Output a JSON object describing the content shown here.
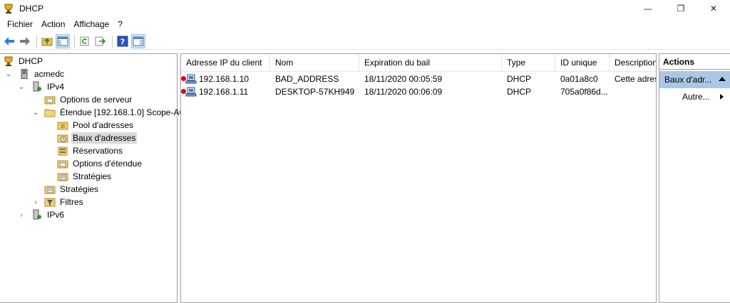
{
  "window": {
    "title": "DHCP",
    "minimize": "—",
    "maximize": "❐",
    "close": "✕"
  },
  "menu": [
    "Fichier",
    "Action",
    "Affichage",
    "?"
  ],
  "tree": {
    "root": "DHCP",
    "server": "acmedc",
    "ipv4": "IPv4",
    "server_options": "Options de serveur",
    "scope": "Étendue [192.168.1.0] Scope-AC",
    "address_pool": "Pool d'adresses",
    "address_leases": "Baux d'adresses",
    "reservations": "Réservations",
    "scope_options": "Options d'étendue",
    "scope_policies": "Stratégies",
    "policies": "Stratégies",
    "filters": "Filtres",
    "ipv6": "IPv6"
  },
  "list": {
    "columns": [
      "Adresse IP du client",
      "Nom",
      "Expiration du bail",
      "Type",
      "ID unique",
      "Description"
    ],
    "rows": [
      {
        "ip": "192.168.1.10",
        "name": "BAD_ADDRESS",
        "expires": "18/11/2020 00:05:59",
        "type": "DHCP",
        "uid": "0a01a8c0",
        "desc": "Cette adres"
      },
      {
        "ip": "192.168.1.11",
        "name": "DESKTOP-57KH949",
        "expires": "18/11/2020 00:06:09",
        "type": "DHCP",
        "uid": "705a0f86d...",
        "desc": ""
      }
    ]
  },
  "actions": {
    "header": "Actions",
    "selected": "Baux d'adr...",
    "more": "Autre..."
  }
}
